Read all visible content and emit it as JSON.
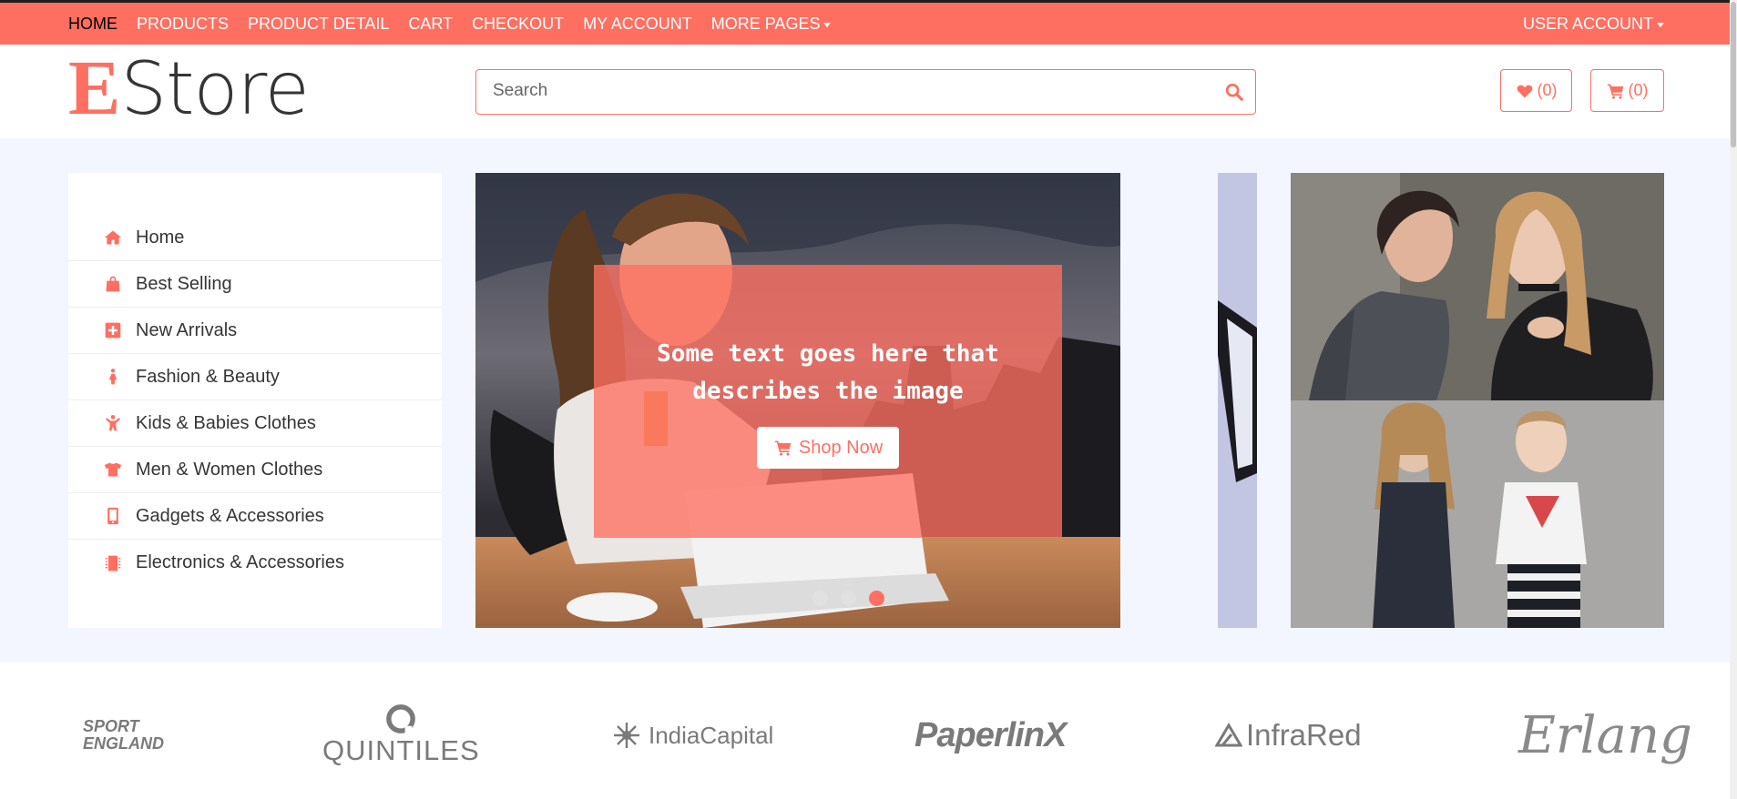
{
  "topnav": {
    "items": [
      {
        "label": "HOME",
        "active": true
      },
      {
        "label": "PRODUCTS"
      },
      {
        "label": "PRODUCT DETAIL"
      },
      {
        "label": "CART"
      },
      {
        "label": "CHECKOUT"
      },
      {
        "label": "MY ACCOUNT"
      },
      {
        "label": "MORE PAGES",
        "dropdown": true
      }
    ],
    "user_account": "USER ACCOUNT"
  },
  "header": {
    "logo_first": "E",
    "logo_rest": "Store",
    "search_placeholder": "Search",
    "wishlist_count": "(0)",
    "cart_count": "(0)"
  },
  "sidebar": {
    "items": [
      {
        "label": "Home",
        "icon": "home-icon"
      },
      {
        "label": "Best Selling",
        "icon": "shopping-bag-icon"
      },
      {
        "label": "New Arrivals",
        "icon": "plus-square-icon"
      },
      {
        "label": "Fashion & Beauty",
        "icon": "female-icon"
      },
      {
        "label": "Kids & Babies Clothes",
        "icon": "child-icon"
      },
      {
        "label": "Men & Women Clothes",
        "icon": "tshirt-icon"
      },
      {
        "label": "Gadgets & Accessories",
        "icon": "mobile-icon"
      },
      {
        "label": "Electronics & Accessories",
        "icon": "microchip-icon"
      }
    ]
  },
  "slider": {
    "caption": "Some text goes here that describes the image",
    "button_label": "Shop Now",
    "slide_count": 3,
    "active_slide": 3
  },
  "brands": {
    "sport_line1": "SPORT",
    "sport_line2": "ENGLAND",
    "quintiles": "QUINTILES",
    "indiacapital": "IndiaCapital",
    "paperlinx": "PaperlinX",
    "infrared": "InfraRed",
    "erlang": "Erlang"
  },
  "colors": {
    "accent": "#ff6f61",
    "hero_bg": "#f3f6ff",
    "text": "#353535"
  }
}
